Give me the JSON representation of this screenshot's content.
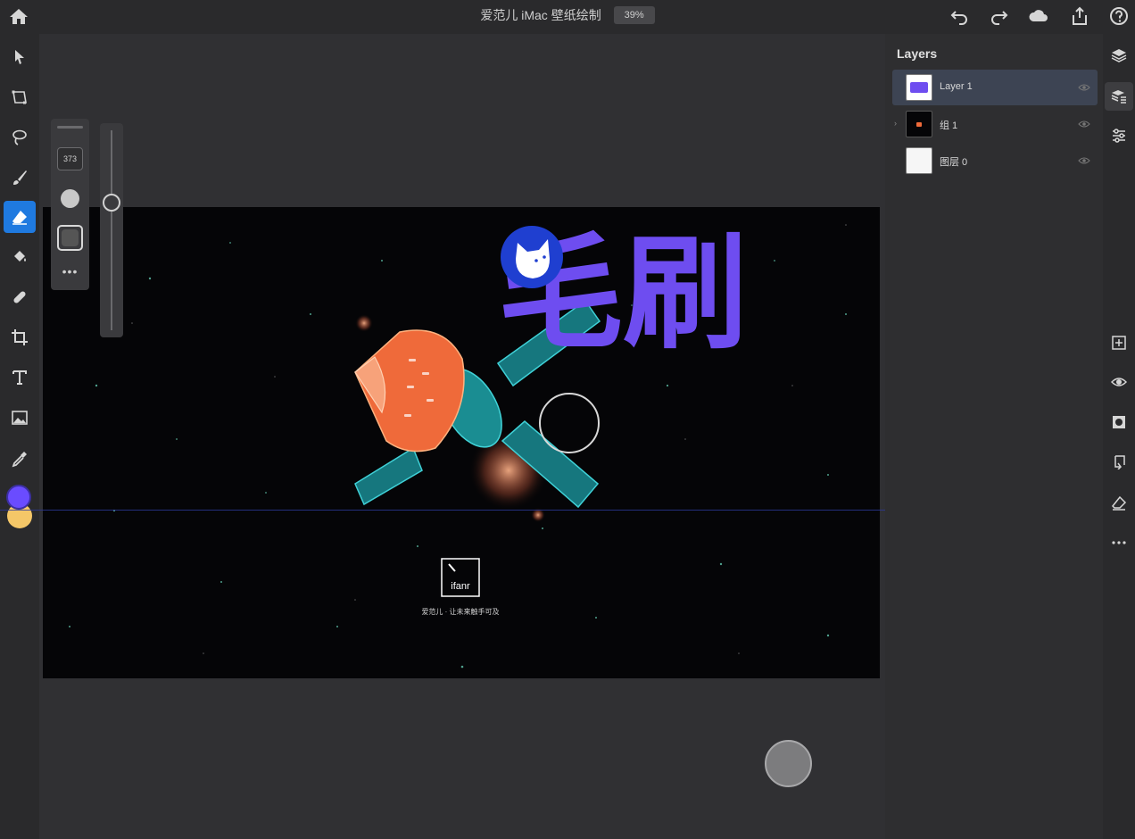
{
  "app": {
    "document_title": "爱范儿 iMac 壁纸绘制",
    "zoom": "39%"
  },
  "topbar": {
    "icons": [
      "home-icon",
      "undo-icon",
      "redo-icon",
      "cloud-icon",
      "share-icon",
      "help-icon"
    ]
  },
  "left_tools": [
    {
      "name": "select-tool",
      "icon": "arrow-icon"
    },
    {
      "name": "transform-tool",
      "icon": "transform-icon"
    },
    {
      "name": "lasso-tool",
      "icon": "lasso-icon"
    },
    {
      "name": "brush-tool",
      "icon": "brush-icon"
    },
    {
      "name": "eraser-tool",
      "icon": "eraser-icon",
      "active": true
    },
    {
      "name": "fill-tool",
      "icon": "bucket-icon"
    },
    {
      "name": "healing-tool",
      "icon": "bandage-icon"
    },
    {
      "name": "crop-tool",
      "icon": "crop-icon"
    },
    {
      "name": "text-tool",
      "icon": "text-icon"
    },
    {
      "name": "image-tool",
      "icon": "image-icon"
    },
    {
      "name": "eyedropper-tool",
      "icon": "eyedropper-icon"
    }
  ],
  "colors": {
    "foreground": "#6a4cff",
    "background": "#f5c768",
    "accent": "#1f7ae0",
    "brush_stroke": "#6e4df0"
  },
  "brush_panel": {
    "size": "373"
  },
  "canvas": {
    "drawn_text": "毛刷",
    "logo_text": "ifanr",
    "caption": "爱范儿 · 让未来触手可及"
  },
  "layers": {
    "title": "Layers",
    "items": [
      {
        "name": "Layer 1",
        "selected": true,
        "has_caret": false
      },
      {
        "name": "组 1",
        "selected": false,
        "has_caret": true
      },
      {
        "name": "图层 0",
        "selected": false,
        "has_caret": false
      }
    ]
  },
  "right_tools": [
    {
      "name": "layers-button",
      "icon": "layers-icon"
    },
    {
      "name": "layer-properties-button",
      "icon": "layer-properties-icon",
      "active": true
    },
    {
      "name": "adjustments-button",
      "icon": "sliders-icon"
    },
    {
      "name": "add-layer-button",
      "icon": "add-layer-icon"
    },
    {
      "name": "visibility-button",
      "icon": "eye-icon"
    },
    {
      "name": "mask-button",
      "icon": "mask-icon"
    },
    {
      "name": "clip-button",
      "icon": "clip-icon"
    },
    {
      "name": "erase-layer-button",
      "icon": "eraser-icon"
    },
    {
      "name": "more-button",
      "icon": "more-icon"
    }
  ]
}
